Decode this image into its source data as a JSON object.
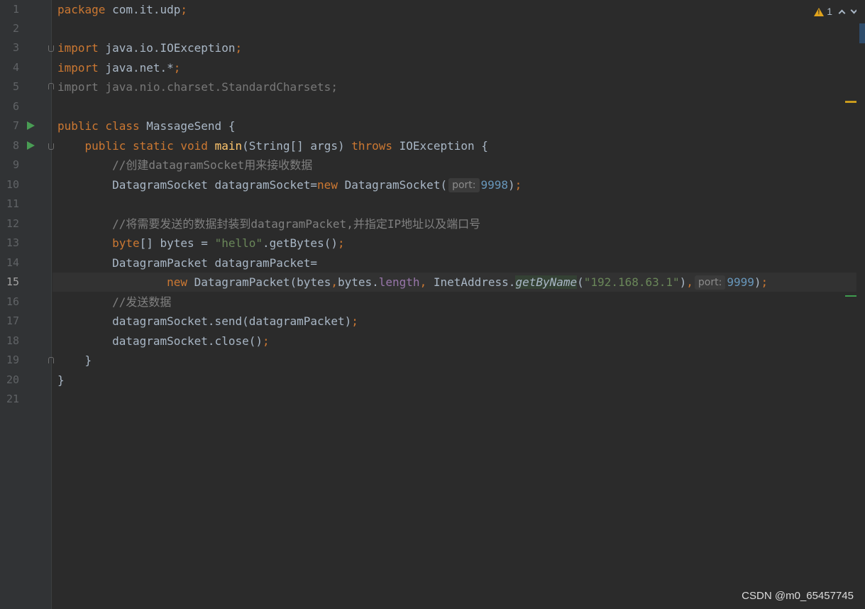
{
  "inspection": {
    "warning_count": "1"
  },
  "lines": [
    {
      "n": "1"
    },
    {
      "n": "2"
    },
    {
      "n": "3"
    },
    {
      "n": "4"
    },
    {
      "n": "5"
    },
    {
      "n": "6"
    },
    {
      "n": "7"
    },
    {
      "n": "8"
    },
    {
      "n": "9"
    },
    {
      "n": "10"
    },
    {
      "n": "11"
    },
    {
      "n": "12"
    },
    {
      "n": "13"
    },
    {
      "n": "14"
    },
    {
      "n": "15"
    },
    {
      "n": "16"
    },
    {
      "n": "17"
    },
    {
      "n": "18"
    },
    {
      "n": "19"
    },
    {
      "n": "20"
    },
    {
      "n": "21"
    }
  ],
  "code": {
    "l1": {
      "kw": "package",
      "rest": " com.it.udp",
      "semi": ";"
    },
    "l3": {
      "kw": "import",
      "rest": " java.io.IOException",
      "semi": ";"
    },
    "l4": {
      "kw": "import",
      "rest": " java.net.*",
      "semi": ";"
    },
    "l5": {
      "text": "import java.nio.charset.StandardCharsets;"
    },
    "l7": {
      "kw": "public class",
      "rest": " MassageSend {"
    },
    "l8": {
      "kw1": "public static void",
      "fn": "main",
      "mid": "(String[] args) ",
      "kw2": "throws",
      "rest": " IOException {"
    },
    "l9": {
      "comment": "//创建datagramSocket用来接收数据"
    },
    "l10": {
      "pre": "DatagramSocket datagramSocket=",
      "kw": "new",
      "post": " DatagramSocket(",
      "hint": "port:",
      "num": "9998",
      "close": ")",
      "semi": ";"
    },
    "l12": {
      "comment": "//将需要发送的数据封装到datagramPacket,并指定IP地址以及端口号"
    },
    "l13": {
      "kw": "byte",
      "mid": "[] bytes = ",
      "str": "\"hello\"",
      "post": ".getBytes()",
      "semi": ";"
    },
    "l14": {
      "text": "DatagramPacket datagramPacket="
    },
    "l15": {
      "kw": "new",
      "pre": " DatagramPacket(bytes",
      "comma1": ",",
      "b2": "bytes.",
      "fld": "length",
      "comma2": ",",
      "ia": " InetAddress.",
      "st": "getByName",
      "open": "(",
      "str": "\"192.168.63.1\"",
      "close": ")",
      "comma3": ",",
      "hint": "port:",
      "num": "9999",
      "end": ")",
      "semi": ";"
    },
    "l16": {
      "comment": "//发送数据"
    },
    "l17": {
      "text": "datagramSocket.send(datagramPacket)",
      "semi": ";"
    },
    "l18": {
      "text": "datagramSocket.close()",
      "semi": ";"
    },
    "l19": {
      "text": "}"
    },
    "l20": {
      "text": "}"
    }
  },
  "watermark": "CSDN @m0_65457745"
}
